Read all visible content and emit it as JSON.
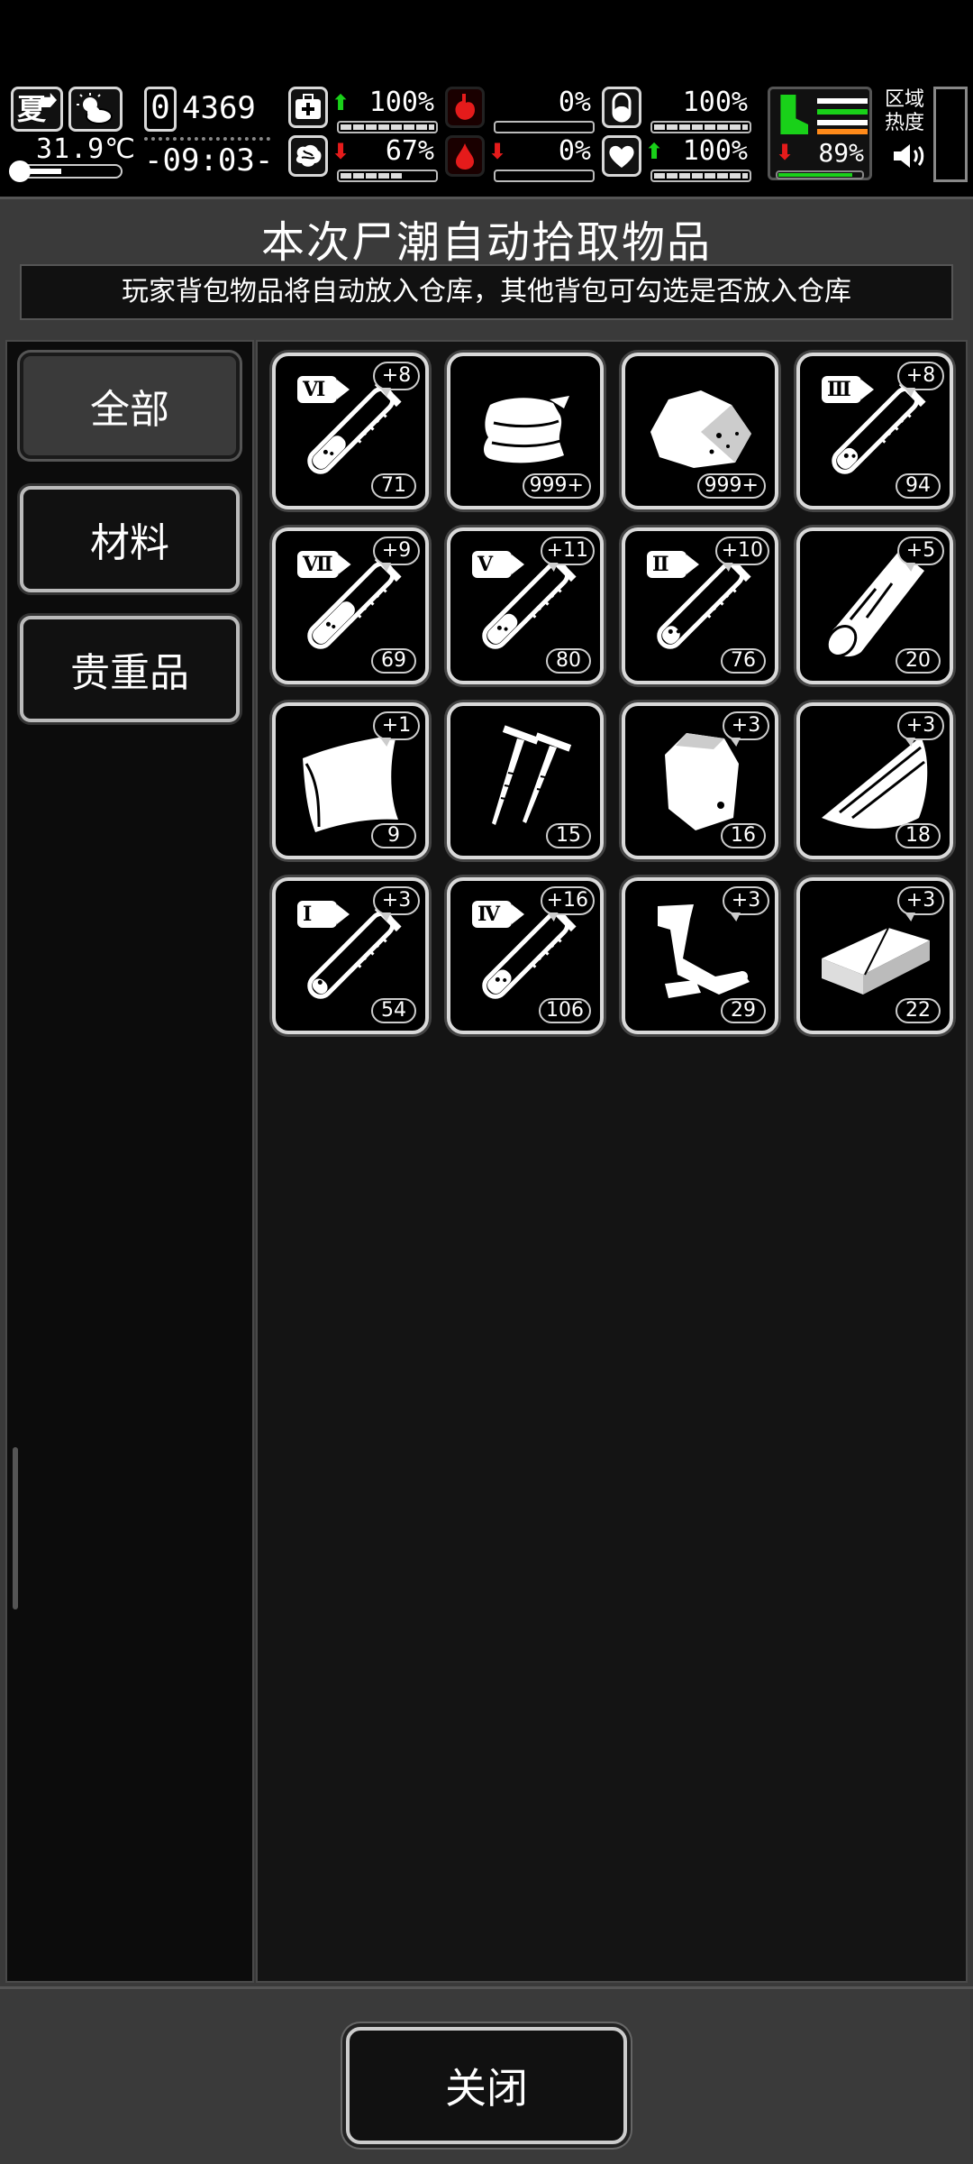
{
  "status": {
    "season": "夏",
    "temperature": "31.9℃",
    "day_digit": "0",
    "money": "4369",
    "time": "-09:03-",
    "stats": [
      {
        "name": "health",
        "arrow": "up",
        "value": "100%",
        "fill": 1.0
      },
      {
        "name": "hunger",
        "arrow": "none",
        "value": "0%",
        "fill": 0.0
      },
      {
        "name": "thirst",
        "arrow": "none",
        "value": "100%",
        "fill": 1.0
      },
      {
        "name": "mental",
        "arrow": "down",
        "value": "67%",
        "fill": 0.67
      },
      {
        "name": "bleeding",
        "arrow": "down",
        "value": "0%",
        "fill": 0.0
      },
      {
        "name": "heart",
        "arrow": "up",
        "value": "100%",
        "fill": 1.0
      }
    ],
    "stamina": {
      "arrow": "down",
      "value": "89%",
      "fill": 0.89
    },
    "zone_label_1": "区域",
    "zone_label_2": "热度",
    "colors": {
      "up_arrow": "#19d119",
      "down_arrow": "#e51b1b",
      "stamina": "#19d119",
      "stripe_green": "#19d119",
      "stripe_orange": "#ff8a1a"
    }
  },
  "panel": {
    "title": "本次尸潮自动拾取物品",
    "subtitle": "玩家背包物品将自动放入仓库，其他背包可勾选是否放入仓库"
  },
  "tabs": [
    {
      "label": "全部",
      "active": true
    },
    {
      "label": "材料",
      "active": false
    },
    {
      "label": "贵重品",
      "active": false
    }
  ],
  "items": [
    {
      "icon": "serum-vial-icon",
      "grade": "Ⅵ",
      "bonus": "+8",
      "count": "71",
      "fill": 0.45
    },
    {
      "icon": "cloth-icon",
      "grade": "",
      "bonus": "",
      "count": "999+"
    },
    {
      "icon": "rock-ore-icon",
      "grade": "",
      "bonus": "",
      "count": "999+"
    },
    {
      "icon": "serum-vial-icon",
      "grade": "Ⅲ",
      "bonus": "+8",
      "count": "94",
      "fill": 0.25
    },
    {
      "icon": "serum-vial-icon",
      "grade": "Ⅶ",
      "bonus": "+9",
      "count": "69",
      "fill": 0.6
    },
    {
      "icon": "serum-vial-icon",
      "grade": "Ⅴ",
      "bonus": "+11",
      "count": "80",
      "fill": 0.4
    },
    {
      "icon": "serum-vial-icon",
      "grade": "Ⅱ",
      "bonus": "+10",
      "count": "76",
      "fill": 0.2
    },
    {
      "icon": "wood-log-icon",
      "grade": "",
      "bonus": "+5",
      "count": "20"
    },
    {
      "icon": "metal-sheet-icon",
      "grade": "",
      "bonus": "+1",
      "count": "9"
    },
    {
      "icon": "nails-icon",
      "grade": "",
      "bonus": "",
      "count": "15"
    },
    {
      "icon": "iron-block-icon",
      "grade": "",
      "bonus": "+3",
      "count": "16"
    },
    {
      "icon": "scrap-plank-icon",
      "grade": "",
      "bonus": "+3",
      "count": "18"
    },
    {
      "icon": "serum-vial-icon",
      "grade": "Ⅰ",
      "bonus": "+3",
      "count": "54",
      "fill": 0.15
    },
    {
      "icon": "serum-vial-icon",
      "grade": "Ⅳ",
      "bonus": "+16",
      "count": "106",
      "fill": 0.3
    },
    {
      "icon": "pipe-scrap-icon",
      "grade": "",
      "bonus": "+3",
      "count": "29"
    },
    {
      "icon": "brick-icon",
      "grade": "",
      "bonus": "+3",
      "count": "22"
    }
  ],
  "footer": {
    "close_label": "关闭"
  }
}
